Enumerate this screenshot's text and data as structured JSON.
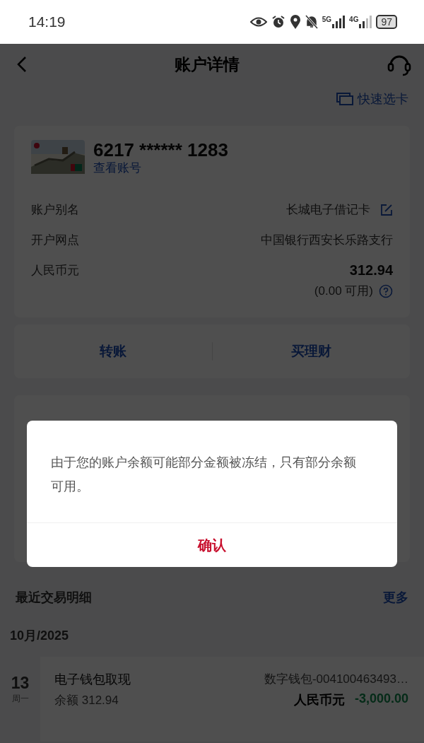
{
  "status_bar": {
    "time": "14:19",
    "network_1": "5G",
    "network_2": "4G",
    "battery": "97"
  },
  "nav": {
    "title": "账户详情"
  },
  "quick_card_link": "快速选卡",
  "account_card": {
    "number": "6217 ****** 1283",
    "view_number_link": "查看账号",
    "rows": [
      {
        "kind": "editable",
        "label": "账户别名",
        "value": "长城电子借记卡"
      },
      {
        "kind": "plain",
        "label": "开户网点",
        "value": "中国银行西安长乐路支行"
      },
      {
        "kind": "balance",
        "label": "人民币元",
        "value": "312.94",
        "available": "(0.00 可用)"
      }
    ]
  },
  "actions": [
    "转账",
    "买理财"
  ],
  "dialog": {
    "message": "由于您的账户余额可能部分金额被冻结，只有部分余额可用。",
    "confirm": "确认"
  },
  "recent": {
    "title": "最近交易明细",
    "more": "更多",
    "month": "10月/2025",
    "transactions": [
      {
        "day": "13",
        "weekday": "周一",
        "title": "电子钱包取现",
        "balance": "余额 312.94",
        "counterparty": "数字钱包-004100463493…",
        "currency": "人民币元",
        "amount": "-3,000.00"
      }
    ]
  }
}
